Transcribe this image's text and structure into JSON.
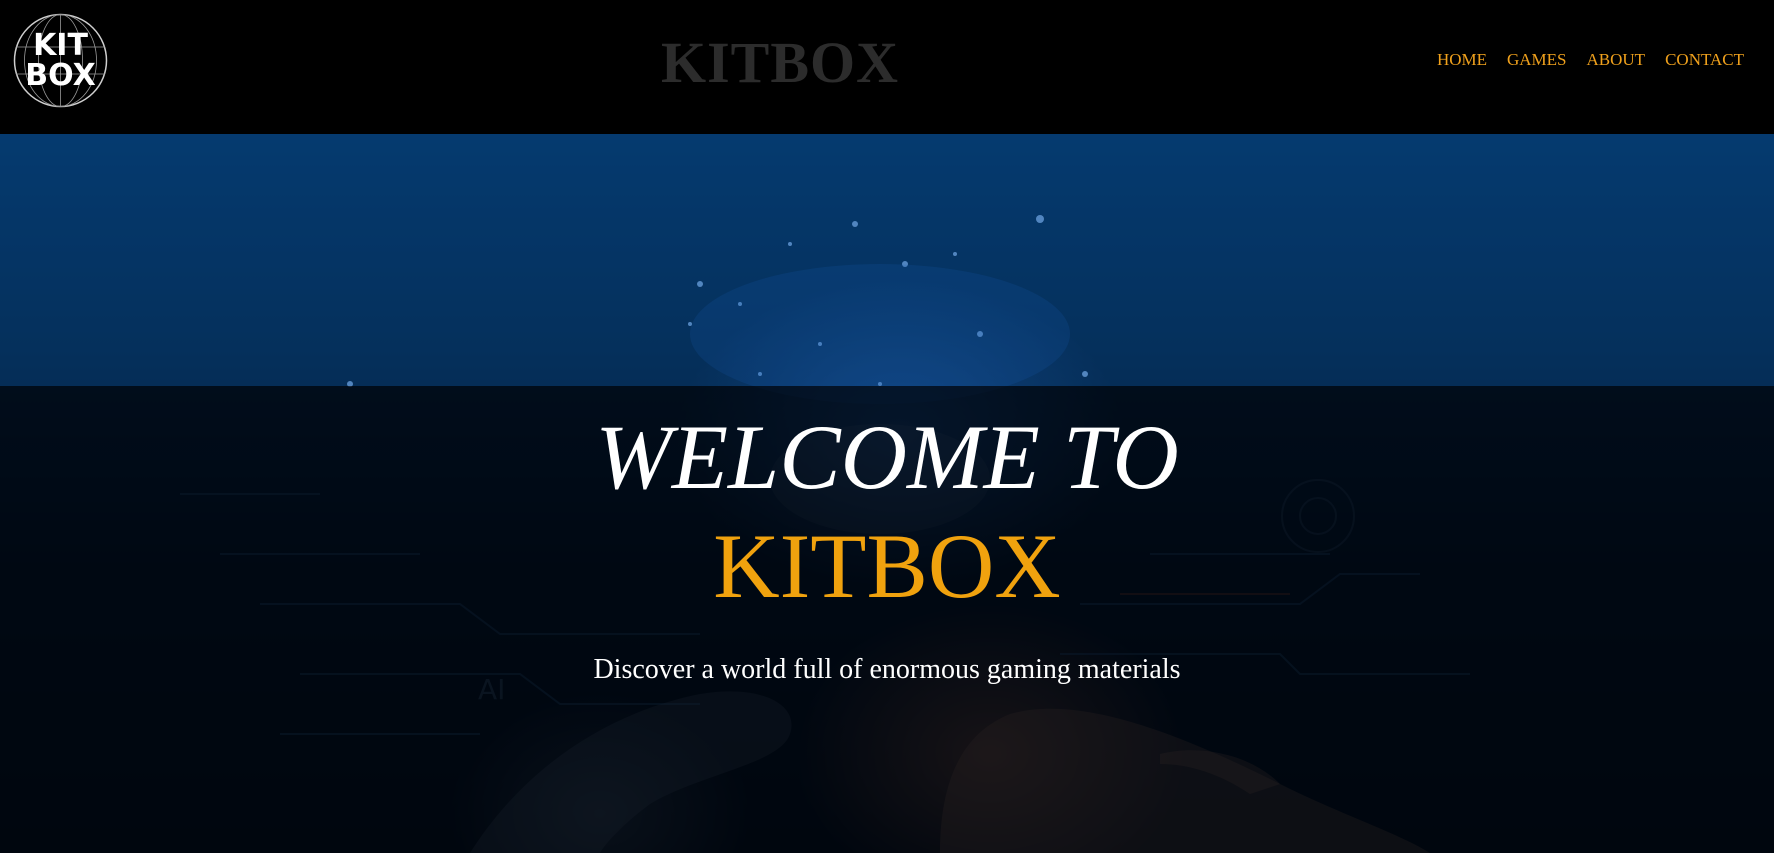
{
  "header": {
    "logo": {
      "line1": "KIT",
      "line2": "BOX"
    },
    "title": "KITBOX",
    "nav": [
      {
        "label": "HOME"
      },
      {
        "label": "GAMES"
      },
      {
        "label": "ABOUT"
      },
      {
        "label": "CONTACT"
      }
    ]
  },
  "hero": {
    "welcome": "WELCOME TO",
    "brand": "KITBOX",
    "tagline": "Discover a world full of enormous gaming materials",
    "decor_label": "AI"
  },
  "colors": {
    "accent": "#f0a11c",
    "header_bg": "#000000",
    "title_color": "#2c2c2c",
    "text": "#ffffff"
  },
  "icons": {
    "logo": "globe-logo-icon"
  }
}
